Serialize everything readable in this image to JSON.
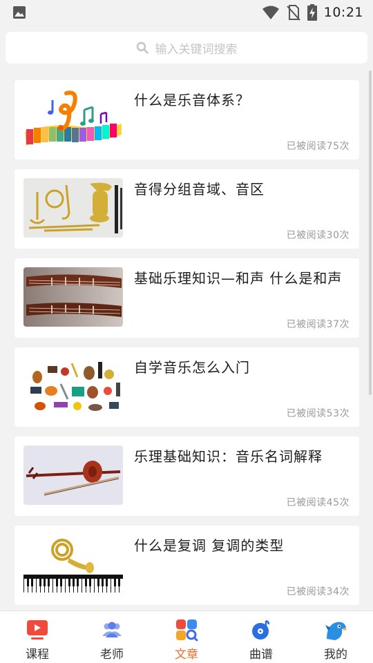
{
  "status_bar": {
    "time": "10:21"
  },
  "search": {
    "placeholder": "输入关键词搜索"
  },
  "articles": [
    {
      "title": "什么是乐音体系？",
      "reads": "已被阅读75次",
      "thumb": "music-notes-keyboard"
    },
    {
      "title": "音得分组音域、音区",
      "reads": "已被阅读30次",
      "thumb": "brass-instruments"
    },
    {
      "title": "基础乐理知识—和声 什么是和声",
      "reads": "已被阅读37次",
      "thumb": "guzheng"
    },
    {
      "title": "自学音乐怎么入门",
      "reads": "已被阅读53次",
      "thumb": "instrument-collection"
    },
    {
      "title": "乐理基础知识：音乐名词解释",
      "reads": "已被阅读45次",
      "thumb": "erhu"
    },
    {
      "title": "什么是复调 复调的类型",
      "reads": "已被阅读34次",
      "thumb": "french-horn-piano"
    }
  ],
  "nav": {
    "items": [
      {
        "label": "课程",
        "icon": "video-play-icon",
        "color": "#f04a3d"
      },
      {
        "label": "老师",
        "icon": "people-icon",
        "color": "#5b7fe8"
      },
      {
        "label": "文章",
        "icon": "article-grid-icon",
        "color": "#f36b2c"
      },
      {
        "label": "曲谱",
        "icon": "music-disc-icon",
        "color": "#2a6ee0"
      },
      {
        "label": "我的",
        "icon": "bird-profile-icon",
        "color": "#2a8fe0"
      }
    ],
    "active_index": 2
  }
}
